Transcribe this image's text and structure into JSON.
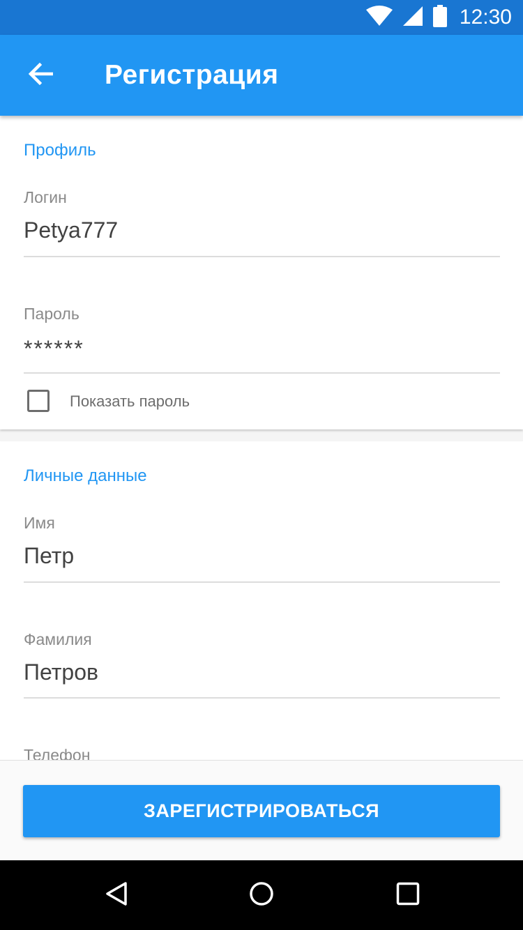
{
  "status_bar": {
    "time": "12:30",
    "icons": [
      "wifi-icon",
      "cell-signal-icon",
      "battery-icon"
    ]
  },
  "app_bar": {
    "title": "Регистрация",
    "back_icon": "arrow-back-icon"
  },
  "profile_section": {
    "title": "Профиль",
    "login": {
      "label": "Логин",
      "value": "Petya777"
    },
    "password": {
      "label": "Пароль",
      "value": "******"
    },
    "show_password": {
      "label": "Показать пароль",
      "checked": false
    }
  },
  "personal_section": {
    "title": "Личные данные",
    "first_name": {
      "label": "Имя",
      "value": "Петр"
    },
    "last_name": {
      "label": "Фамилия",
      "value": "Петров"
    },
    "phone": {
      "label": "Телефон",
      "value": ""
    }
  },
  "register_button": {
    "label": "ЗАРЕГИСТРИРОВАТЬСЯ"
  },
  "nav_bar": {
    "icons": [
      "back-triangle-icon",
      "home-circle-icon",
      "recents-square-icon"
    ]
  },
  "colors": {
    "status_bar": "#1976d2",
    "app_bar": "#2196f3",
    "accent": "#2196f3",
    "nav_bar": "#000000"
  }
}
